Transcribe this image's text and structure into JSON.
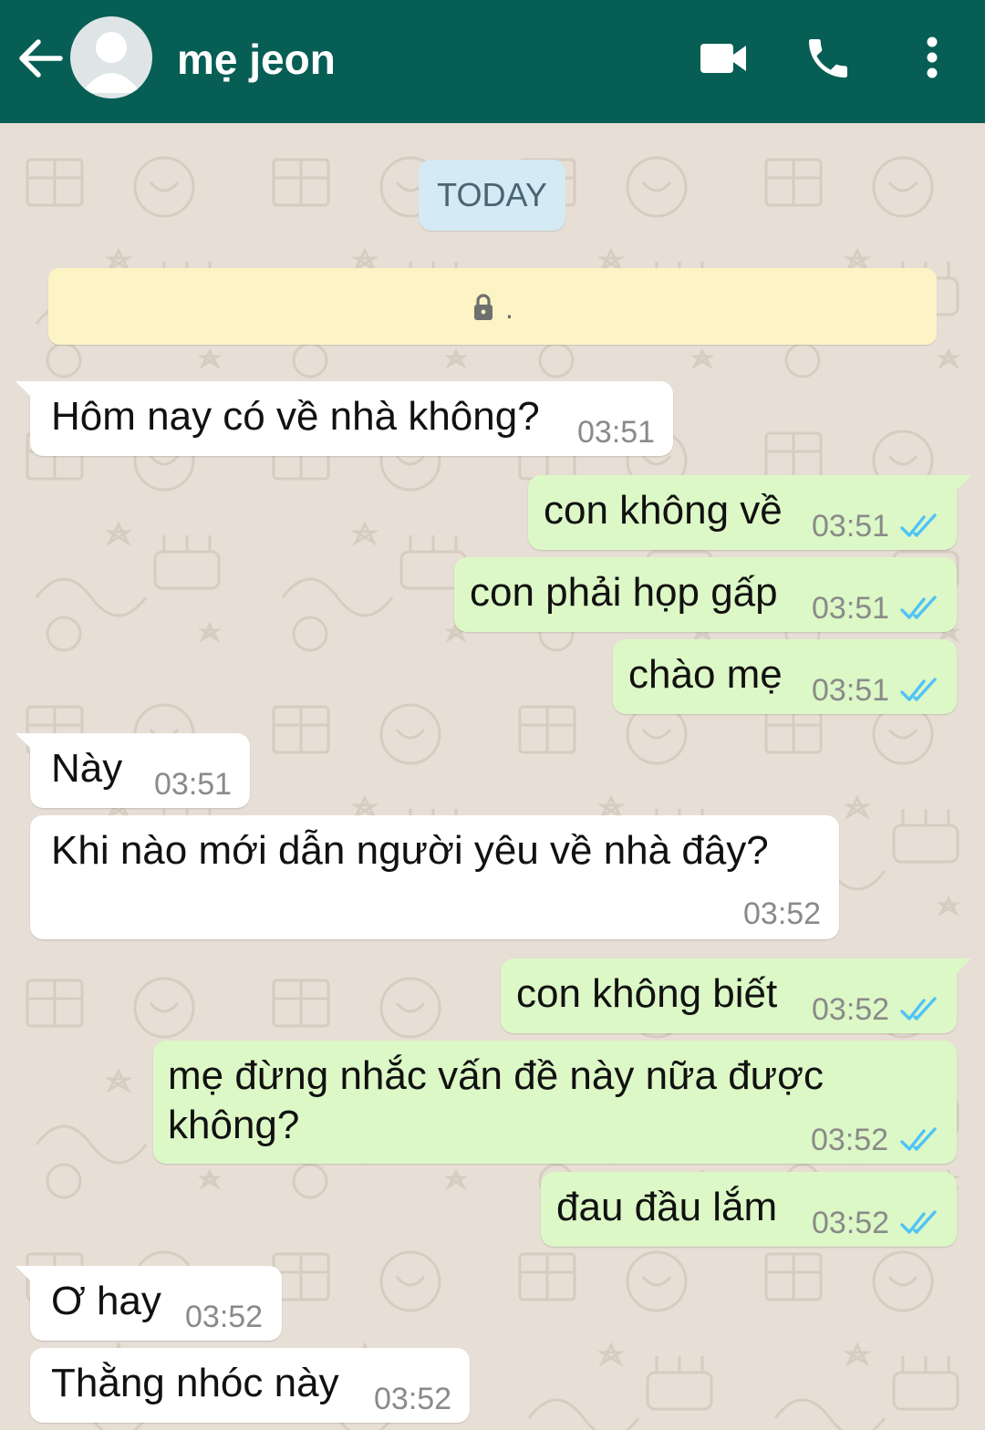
{
  "header": {
    "contact_name": "mẹ jeon",
    "background_color": "#075e54",
    "icons": [
      "back-arrow-icon",
      "avatar-placeholder-icon",
      "video-call-icon",
      "phone-icon",
      "more-options-icon"
    ]
  },
  "date_chip": "TODAY",
  "encryption_notice": {
    "icon": "lock-icon",
    "text": "."
  },
  "messages": [
    {
      "direction": "incoming",
      "text": "Hôm nay có về nhà không?",
      "time": "03:51"
    },
    {
      "direction": "outgoing",
      "text": "con không về",
      "time": "03:51",
      "status": "read"
    },
    {
      "direction": "outgoing",
      "text": "con phải họp gấp",
      "time": "03:51",
      "status": "read"
    },
    {
      "direction": "outgoing",
      "text": "chào mẹ",
      "time": "03:51",
      "status": "read"
    },
    {
      "direction": "incoming",
      "text": "Này",
      "time": "03:51"
    },
    {
      "direction": "incoming",
      "text": "Khi nào mới dẫn người yêu về nhà đây?",
      "time": "03:52"
    },
    {
      "direction": "outgoing",
      "text": "con không biết",
      "time": "03:52",
      "status": "read"
    },
    {
      "direction": "outgoing",
      "text": "mẹ đừng nhắc vấn đề này nữa được không?",
      "time": "03:52",
      "status": "read"
    },
    {
      "direction": "outgoing",
      "text": "đau đầu lắm",
      "time": "03:52",
      "status": "read"
    },
    {
      "direction": "incoming",
      "text": "Ơ hay",
      "time": "03:52"
    },
    {
      "direction": "incoming",
      "text": "Thằng nhóc này",
      "time": "03:52"
    }
  ],
  "colors": {
    "incoming_bubble": "#ffffff",
    "outgoing_bubble": "#dcf8c6",
    "read_ticks": "#4fc3f7",
    "chat_background": "#e7ded5"
  }
}
